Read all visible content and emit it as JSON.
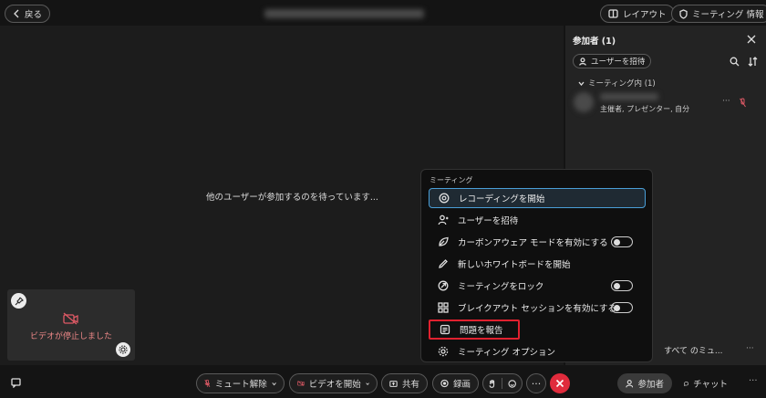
{
  "header": {
    "back_label": "戻る",
    "layout_label": "レイアウト",
    "meeting_info_label": "ミーティング 情報"
  },
  "main": {
    "waiting_text": "他のユーザーが参加するのを待っています..."
  },
  "self_view": {
    "video_stopped_text": "ビデオが停止しました"
  },
  "participants_panel": {
    "title": "参加者 (1)",
    "invite_label": "ユーザーを招待",
    "section_label": "ミーティング内 (1)",
    "participant_role": "主催者, プレゼンター, 自分",
    "bottom_text": "すべて のミュ..."
  },
  "menu": {
    "section_label": "ミーティング",
    "items": [
      {
        "label": "レコーディングを開始",
        "icon": "record-icon"
      },
      {
        "label": "ユーザーを招待",
        "icon": "add-person-icon"
      },
      {
        "label": "カーボンアウェア モードを有効にする",
        "icon": "leaf-icon",
        "toggle": false
      },
      {
        "label": "新しいホワイトボードを開始",
        "icon": "pencil-icon"
      },
      {
        "label": "ミーティングをロック",
        "icon": "lock-icon",
        "toggle": false
      },
      {
        "label": "ブレイクアウト セッションを有効にする",
        "icon": "grid-icon",
        "toggle": false
      },
      {
        "label": "問題を報告",
        "icon": "report-icon"
      },
      {
        "label": "ミーティング オプション",
        "icon": "gear-icon"
      }
    ]
  },
  "toolbar": {
    "unmute_label": "ミュート解除",
    "start_video_label": "ビデオを開始",
    "share_label": "共有",
    "record_label": "録画",
    "participants_label": "参加者",
    "chat_label": "チャット"
  },
  "colors": {
    "end_call": "#e02b3c",
    "muted_red": "#e05a66",
    "highlight_blue": "#4a9fd8",
    "report_outline": "#e0212f"
  }
}
